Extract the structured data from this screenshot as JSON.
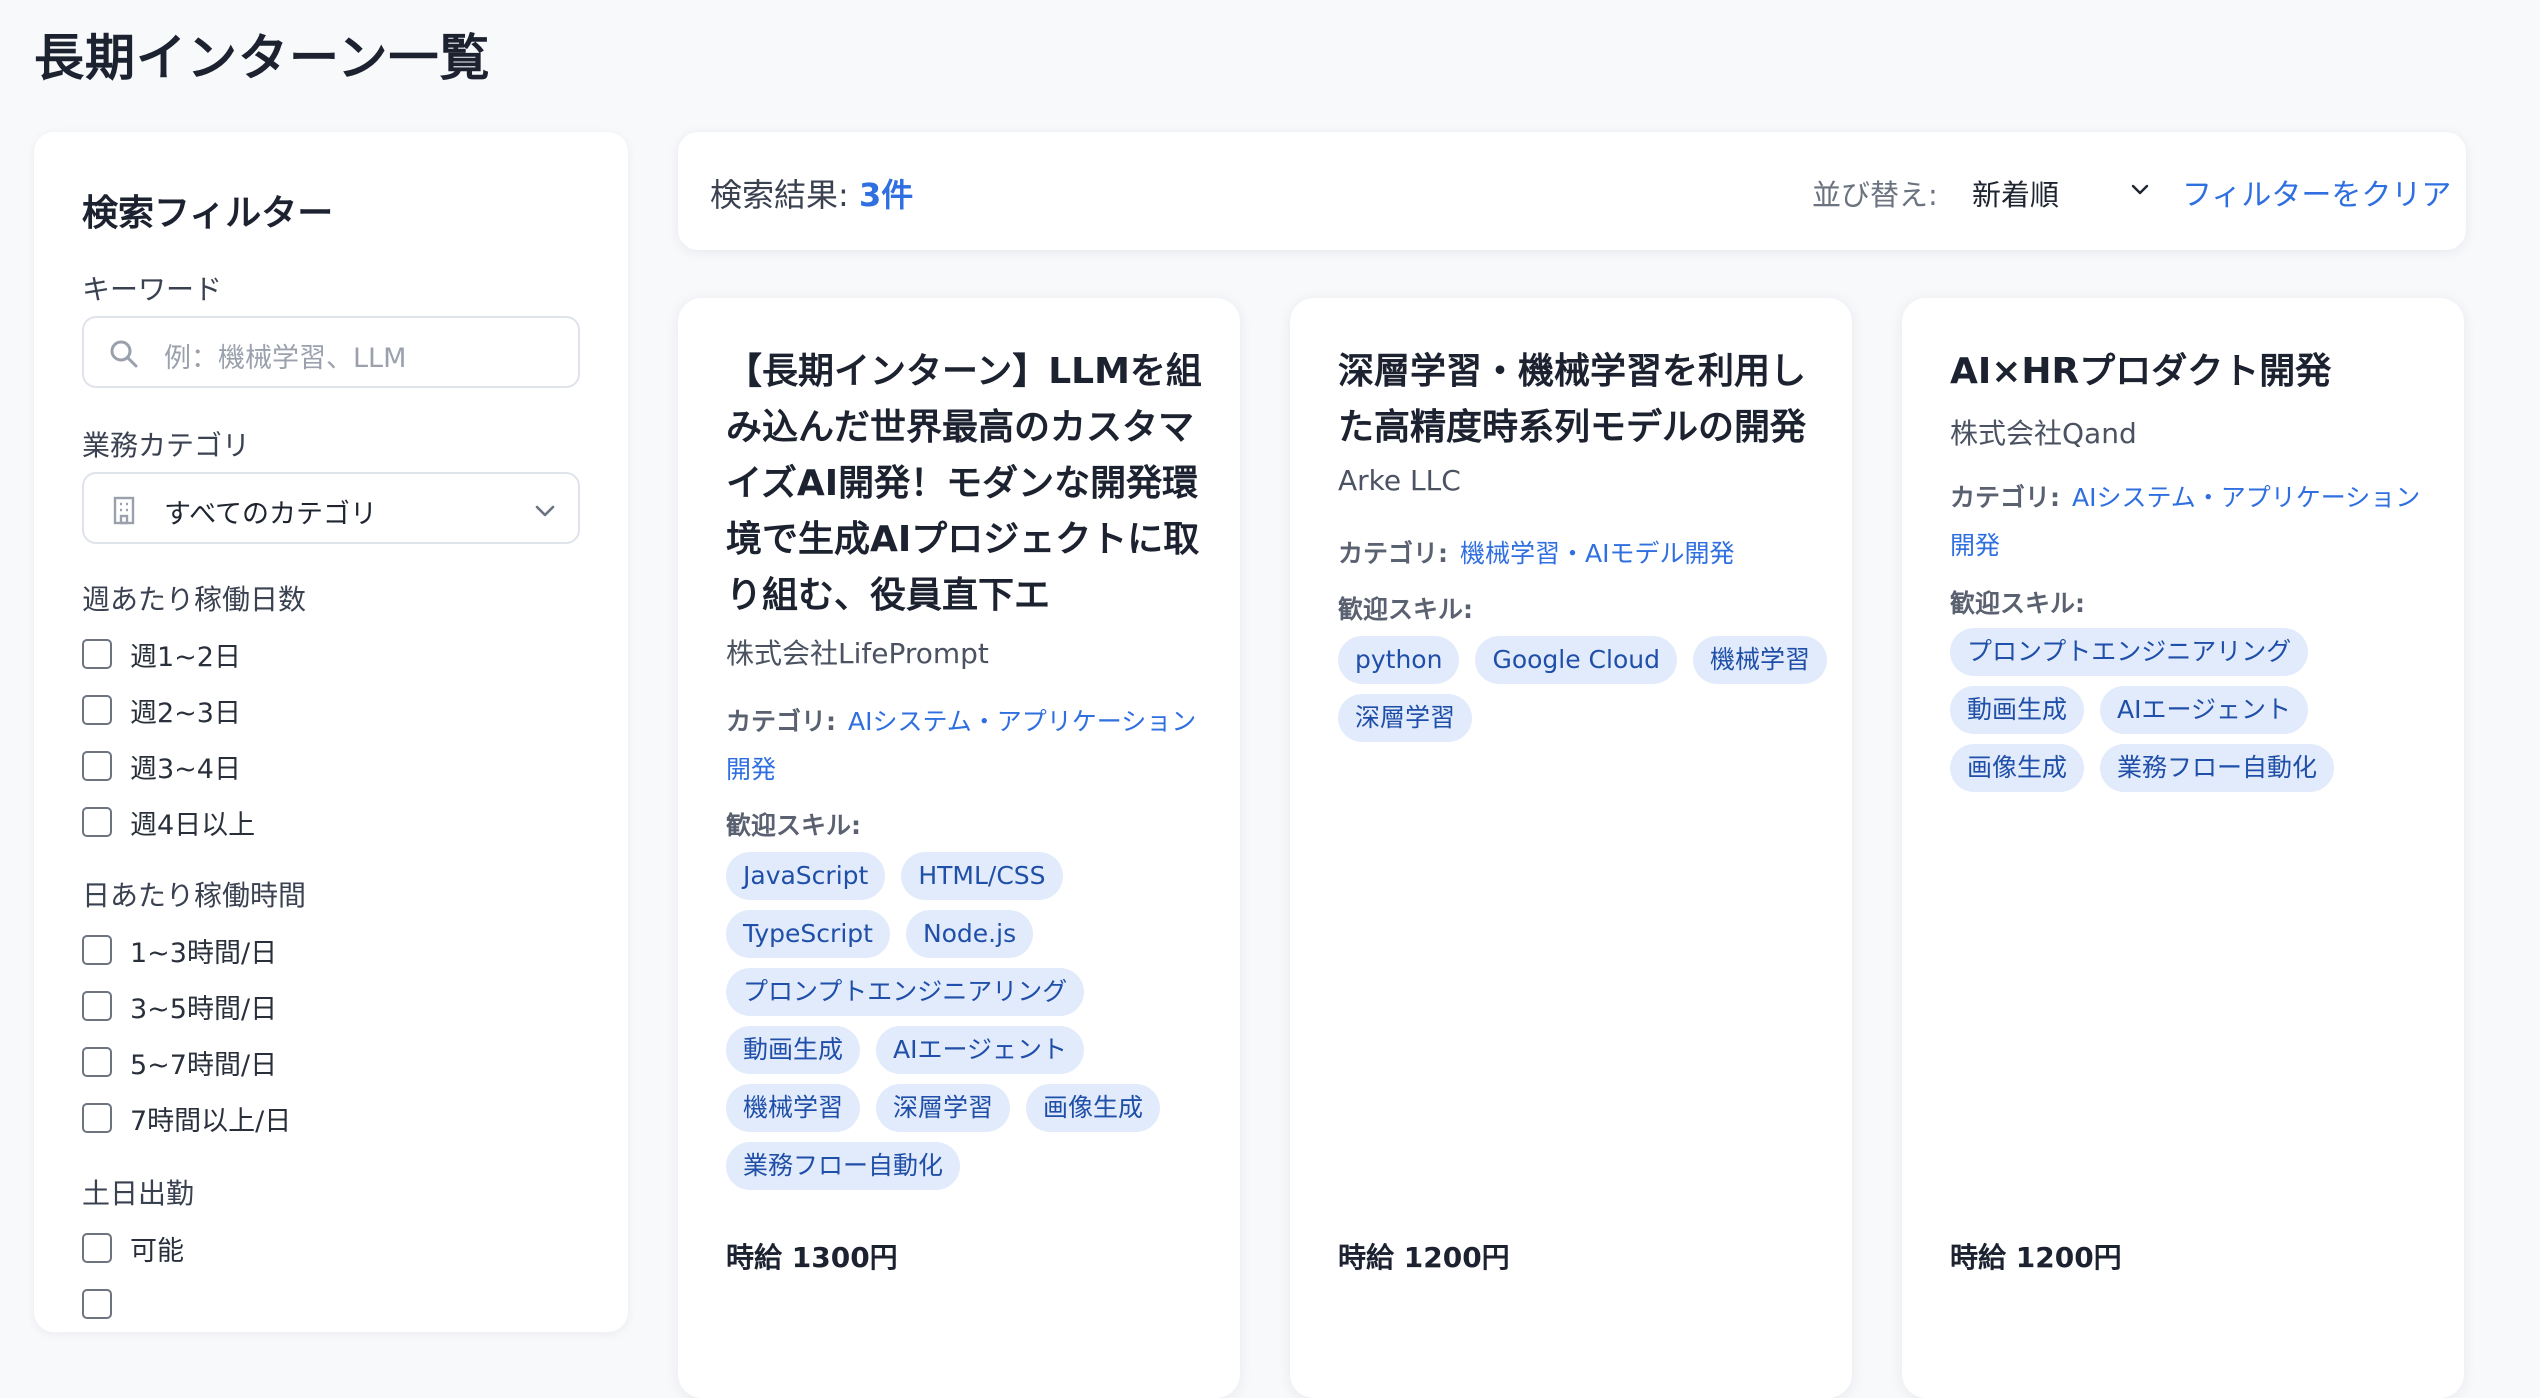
{
  "page": {
    "title": "長期インターン一覧"
  },
  "sidebar": {
    "title": "検索フィルター",
    "keyword": {
      "label": "キーワード",
      "placeholder": "例：機械学習、LLM",
      "icon": "search-icon"
    },
    "category": {
      "label": "業務カテゴリ",
      "value": "すべてのカテゴリ",
      "icon": "building-icon"
    },
    "days_per_week": {
      "label": "週あたり稼働日数",
      "options": [
        "週1~2日",
        "週2~3日",
        "週3~4日",
        "週4日以上"
      ]
    },
    "hours_per_day": {
      "label": "日あたり稼働時間",
      "options": [
        "1~3時間/日",
        "3~5時間/日",
        "5~7時間/日",
        "7時間以上/日"
      ]
    },
    "weekend": {
      "label": "土日出勤",
      "options": [
        "可能"
      ]
    }
  },
  "results": {
    "label": "検索結果:",
    "count": "3件",
    "sort_label": "並び替え:",
    "sort_value": "新着順",
    "clear": "フィルターをクリア"
  },
  "cards": [
    {
      "title": "【長期インターン】LLMを組み込んだ世界最高のカスタマイズAI開発！モダンな開発環境で生成AIプロジェクトに取り組む、役員直下エ",
      "company": "株式会社LifePrompt",
      "category_label": "カテゴリ:",
      "category": "AIシステム・アプリケーション開発",
      "skills_label": "歓迎スキル:",
      "skills": [
        "JavaScript",
        "HTML/CSS",
        "TypeScript",
        "Node.js",
        "プロンプトエンジニアリング",
        "動画生成",
        "AIエージェント",
        "機械学習",
        "深層学習",
        "画像生成",
        "業務フロー自動化"
      ],
      "wage": "時給 1300円"
    },
    {
      "title": "深層学習・機械学習を利用した高精度時系列モデルの開発",
      "company": "Arke LLC",
      "category_label": "カテゴリ:",
      "category": "機械学習・AIモデル開発",
      "skills_label": "歓迎スキル:",
      "skills": [
        "python",
        "Google Cloud",
        "機械学習",
        "深層学習"
      ],
      "wage": "時給 1200円"
    },
    {
      "title": "AI×HRプロダクト開発",
      "company": "株式会社Qand",
      "category_label": "カテゴリ:",
      "category": "AIシステム・アプリケーション開発",
      "skills_label": "歓迎スキル:",
      "skills": [
        "プロンプトエンジニアリング",
        "動画生成",
        "AIエージェント",
        "画像生成",
        "業務フロー自動化"
      ],
      "wage": "時給 1200円"
    }
  ],
  "colors": {
    "accent": "#2f6fe0",
    "tag_bg": "#e2ebfb",
    "tag_text": "#1f4fa8"
  }
}
